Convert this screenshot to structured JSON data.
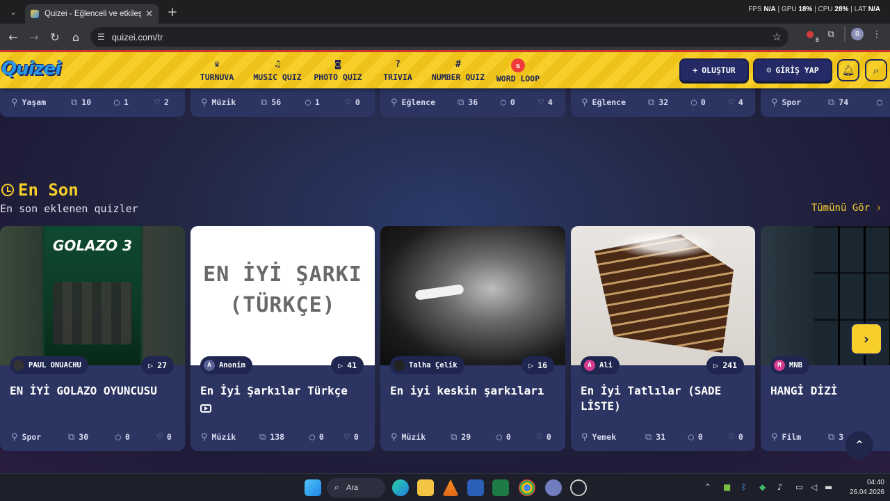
{
  "browser": {
    "tab_title": "Quizei - Eğlenceli ve etkileşimli",
    "url": "quizei.com/tr",
    "perf": {
      "fps_label": "FPS",
      "fps": "N/A",
      "gpu_label": "GPU",
      "gpu": "18%",
      "cpu_label": "CPU",
      "cpu": "28%",
      "lat_label": "LAT",
      "lat": "N/A"
    },
    "ext_badge": "8",
    "profile_initial": "B"
  },
  "site": {
    "logo": "Quizei",
    "nav": [
      {
        "label": "TURNUVA",
        "icon": "trophy-icon"
      },
      {
        "label": "MUSIC QUIZ",
        "icon": "music-note-icon"
      },
      {
        "label": "PHOTO QUIZ",
        "icon": "camera-icon"
      },
      {
        "label": "TRIVIA",
        "icon": "question-icon"
      },
      {
        "label": "NUMBER QUIZ",
        "icon": "hash-icon"
      },
      {
        "label": "WORD LOOP",
        "icon": "sort-icon"
      }
    ],
    "create_label": "OLUŞTUR",
    "login_label": "GİRİŞ YAP"
  },
  "top_stats": [
    {
      "category": "Yaşam",
      "questions": "10",
      "comments": "1",
      "likes": "2"
    },
    {
      "category": "Müzik",
      "questions": "56",
      "comments": "1",
      "likes": "0"
    },
    {
      "category": "Eğlence",
      "questions": "36",
      "comments": "0",
      "likes": "4"
    },
    {
      "category": "Eğlence",
      "questions": "32",
      "comments": "0",
      "likes": "4"
    },
    {
      "category": "Spor",
      "questions": "74",
      "comments": "",
      "likes": ""
    }
  ],
  "section": {
    "title": "En Son",
    "subtitle": "En son eklenen quizler",
    "see_all": "Tümünü Gör"
  },
  "cards": [
    {
      "author": "PAUL ONUACHU",
      "plays": "27",
      "title": "EN İYİ GOLAZO OYUNCUSU",
      "category": "Spor",
      "questions": "30",
      "comments": "0",
      "likes": "0",
      "thumb_text": "GOLAZO 3"
    },
    {
      "author": "Anonim",
      "author_initial": "A",
      "plays": "41",
      "title": "En İyi Şarkılar Türkçe",
      "category": "Müzik",
      "questions": "138",
      "comments": "0",
      "likes": "0",
      "thumb_text": "EN İYİ ŞARKI (TÜRKÇE)"
    },
    {
      "author": "Talha Çelik",
      "plays": "16",
      "title": "En iyi keskin şarkıları",
      "category": "Müzik",
      "questions": "29",
      "comments": "0",
      "likes": "0"
    },
    {
      "author": "Ali",
      "author_initial": "A",
      "plays": "241",
      "title": "En İyi Tatlılar (SADE LİSTE)",
      "category": "Yemek",
      "questions": "31",
      "comments": "0",
      "likes": "0"
    },
    {
      "author": "MNB",
      "author_initial": "M",
      "plays": "",
      "title": "HANGİ DİZİ",
      "category": "Film",
      "questions": "3",
      "comments": "",
      "likes": ""
    }
  ],
  "taskbar": {
    "search_label": "Ara",
    "time": "04:40",
    "date": "26.04.2026"
  }
}
